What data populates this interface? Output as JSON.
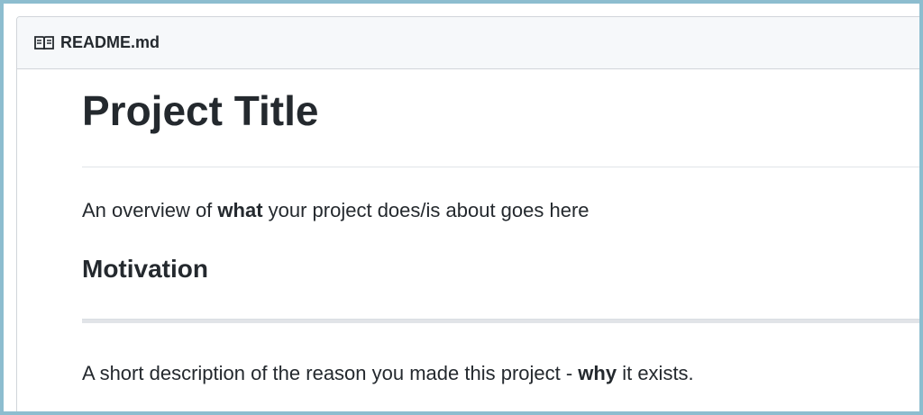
{
  "file": {
    "name": "README.md",
    "icon": "book-icon"
  },
  "readme": {
    "title": "Project Title",
    "overview": {
      "before": "An overview of ",
      "bold": "what",
      "after": " your project does/is about goes here"
    },
    "motivation_heading": "Motivation",
    "short_description": {
      "before": "A short description of the reason you made this project - ",
      "bold": "why",
      "after": " it exists."
    }
  },
  "colors": {
    "frame_border": "#8dbdcf",
    "header_bg": "#f6f8fa",
    "text": "#24292e",
    "divider": "#e1e4e8"
  }
}
